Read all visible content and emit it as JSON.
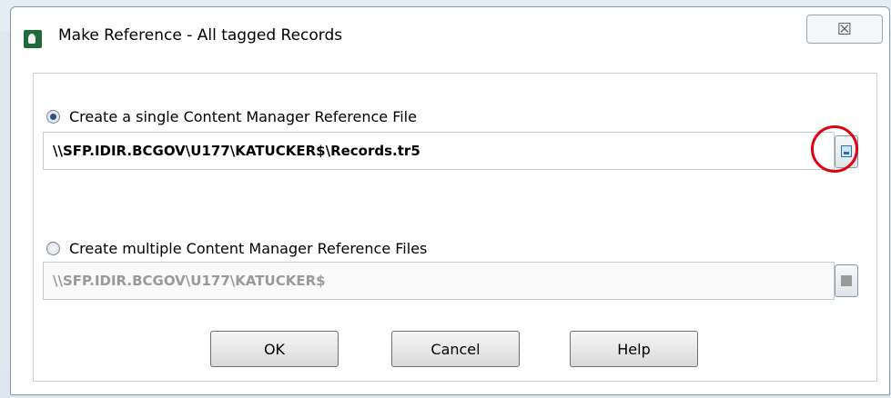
{
  "window": {
    "title": "Make Reference - All tagged Records",
    "close_icon": "close-icon",
    "close_glyph": "☒"
  },
  "options": {
    "single": {
      "label": "Create a single Content Manager Reference File",
      "selected": true,
      "path_value": "\\\\SFP.IDIR.BCGOV\\U177\\KATUCKER$\\Records.tr5",
      "browse_icon": "save-icon",
      "highlighted": true
    },
    "multiple": {
      "label": "Create multiple Content Manager Reference Files",
      "selected": false,
      "path_value": "\\\\SFP.IDIR.BCGOV\\U177\\KATUCKER$",
      "browse_icon": "folder-icon",
      "disabled": true
    }
  },
  "buttons": {
    "ok": "OK",
    "cancel": "Cancel",
    "help": "Help"
  },
  "colors": {
    "highlight_ring": "#e0000e",
    "radio_selected": "#2c4e8a"
  }
}
